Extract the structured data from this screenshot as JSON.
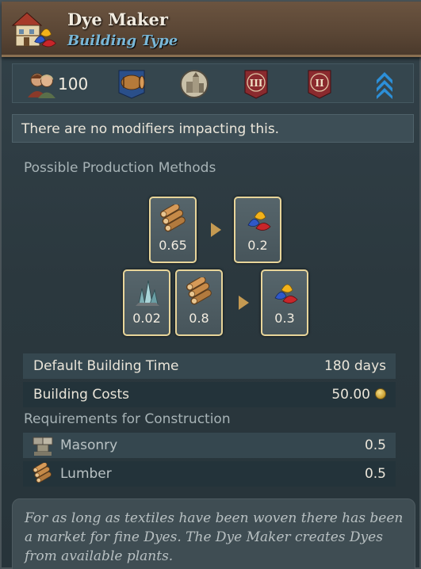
{
  "header": {
    "title": "Dye Maker",
    "subtitle": "Building Type",
    "icon": "building-dye-maker-icon"
  },
  "stats": {
    "population_value": "100",
    "icons": [
      "population-icon",
      "barrel-goods-icon",
      "urban-center-icon",
      "tier-III-banner-icon",
      "tier-II-banner-icon",
      "rank-chevrons-icon"
    ],
    "tier_labels": [
      "III",
      "II"
    ]
  },
  "modifiers": {
    "text": "There are no modifiers impacting this."
  },
  "production": {
    "label": "Possible Production Methods",
    "methods": [
      {
        "inputs": [
          {
            "good": "lumber",
            "value": "0.65"
          }
        ],
        "outputs": [
          {
            "good": "dyes",
            "value": "0.2"
          }
        ]
      },
      {
        "inputs": [
          {
            "good": "crystals",
            "value": "0.02"
          },
          {
            "good": "lumber",
            "value": "0.8"
          }
        ],
        "outputs": [
          {
            "good": "dyes",
            "value": "0.3"
          }
        ]
      }
    ]
  },
  "info": {
    "build_time_label": "Default Building Time",
    "build_time_value": "180 days",
    "cost_label": "Building Costs",
    "cost_value": "50.00"
  },
  "requirements": {
    "label": "Requirements for Construction",
    "items": [
      {
        "name": "Masonry",
        "value": "0.5",
        "icon": "masonry-icon"
      },
      {
        "name": "Lumber",
        "value": "0.5",
        "icon": "lumber-icon"
      }
    ]
  },
  "description": "For as long as textiles have been woven there has been a market for fine Dyes. The Dye Maker creates Dyes from available plants.",
  "colors": {
    "title": "#f2ece0",
    "subtitle": "#79b7d7",
    "card_border": "#e8d59a",
    "arrow": "#c59a52",
    "header_bg": "#5a4635"
  }
}
